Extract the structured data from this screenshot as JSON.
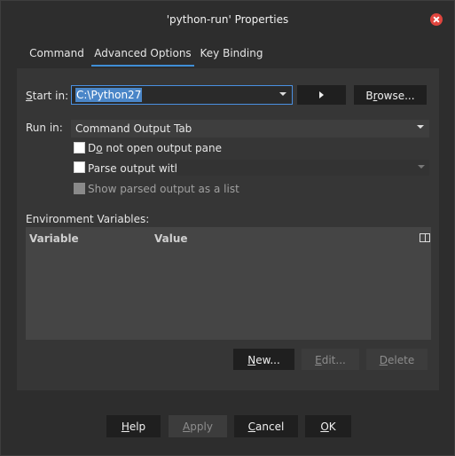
{
  "window": {
    "title": "'python-run' Properties"
  },
  "tabs": [
    {
      "label": "Command",
      "active": false
    },
    {
      "label": "Advanced Options",
      "active": true
    },
    {
      "label": "Key Binding",
      "active": false
    }
  ],
  "start_in": {
    "label_u": "S",
    "label_rest": "tart in:",
    "value": "C:\\Python27"
  },
  "browse": {
    "label_pre": "B",
    "label_u": "r",
    "label_rest": "owse..."
  },
  "run_in": {
    "label": "Run in:",
    "value": "Command Output Tab"
  },
  "options": {
    "no_output_pre": "D",
    "no_output_u": "o",
    "no_output_rest": " not open output pane",
    "parse_output": "Parse output with:",
    "show_parsed": "Show parsed output as a list"
  },
  "env": {
    "label": "Environment Variables:",
    "columns": [
      "Variable",
      "Value"
    ]
  },
  "env_buttons": {
    "new_u": "N",
    "new_rest": "ew...",
    "edit_u": "E",
    "edit_rest": "dit...",
    "delete_u": "D",
    "delete_rest": "elete"
  },
  "footer": {
    "help_u": "H",
    "help_rest": "elp",
    "apply_u": "A",
    "apply_rest": "pply",
    "cancel_u": "C",
    "cancel_rest": "ancel",
    "ok_u": "O",
    "ok_rest": "K"
  },
  "colors": {
    "accent": "#3f8ed6",
    "close": "#e0453e",
    "selection": "#4a86c8"
  }
}
